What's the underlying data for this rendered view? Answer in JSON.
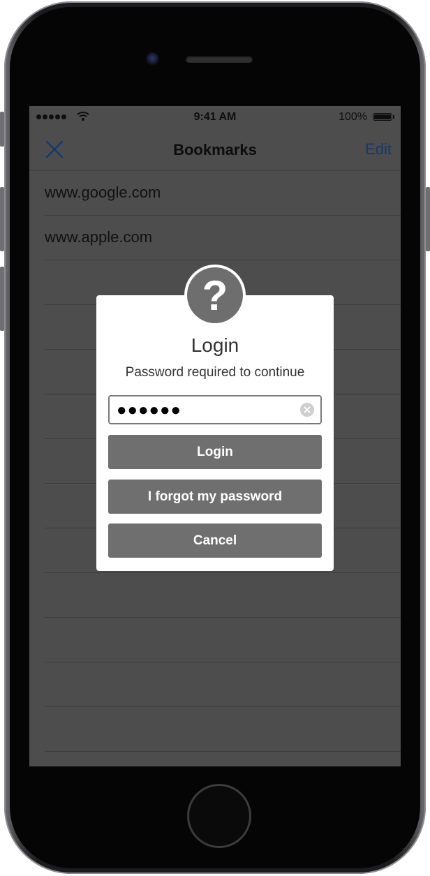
{
  "status_bar": {
    "time": "9:41 AM",
    "battery_percent": "100%",
    "signal_bars": 5,
    "icons": [
      "signal-dots-icon",
      "wifi-icon",
      "battery-icon"
    ]
  },
  "nav_bar": {
    "close_icon": "close-x-icon",
    "title": "Bookmarks",
    "edit_label": "Edit",
    "accent_color": "#143a6b"
  },
  "bookmarks": {
    "items": [
      {
        "label": "www.google.com"
      },
      {
        "label": "www.apple.com"
      },
      {
        "label": ""
      },
      {
        "label": ""
      },
      {
        "label": ""
      },
      {
        "label": ""
      },
      {
        "label": ""
      },
      {
        "label": ""
      },
      {
        "label": ""
      },
      {
        "label": ""
      },
      {
        "label": ""
      },
      {
        "label": ""
      },
      {
        "label": ""
      }
    ]
  },
  "dialog": {
    "badge_symbol": "?",
    "badge_icon": "question-mark-icon",
    "title": "Login",
    "message": "Password required to continue",
    "password": {
      "masked_value": "●●●●●●",
      "clear_icon": "clear-circle-icon"
    },
    "buttons": {
      "login": "Login",
      "forgot": "I forgot my password",
      "cancel": "Cancel"
    },
    "button_color": "#6f6f6f"
  },
  "colors": {
    "screen_background": "#4d4d4d",
    "dialog_background": "#ffffff"
  }
}
